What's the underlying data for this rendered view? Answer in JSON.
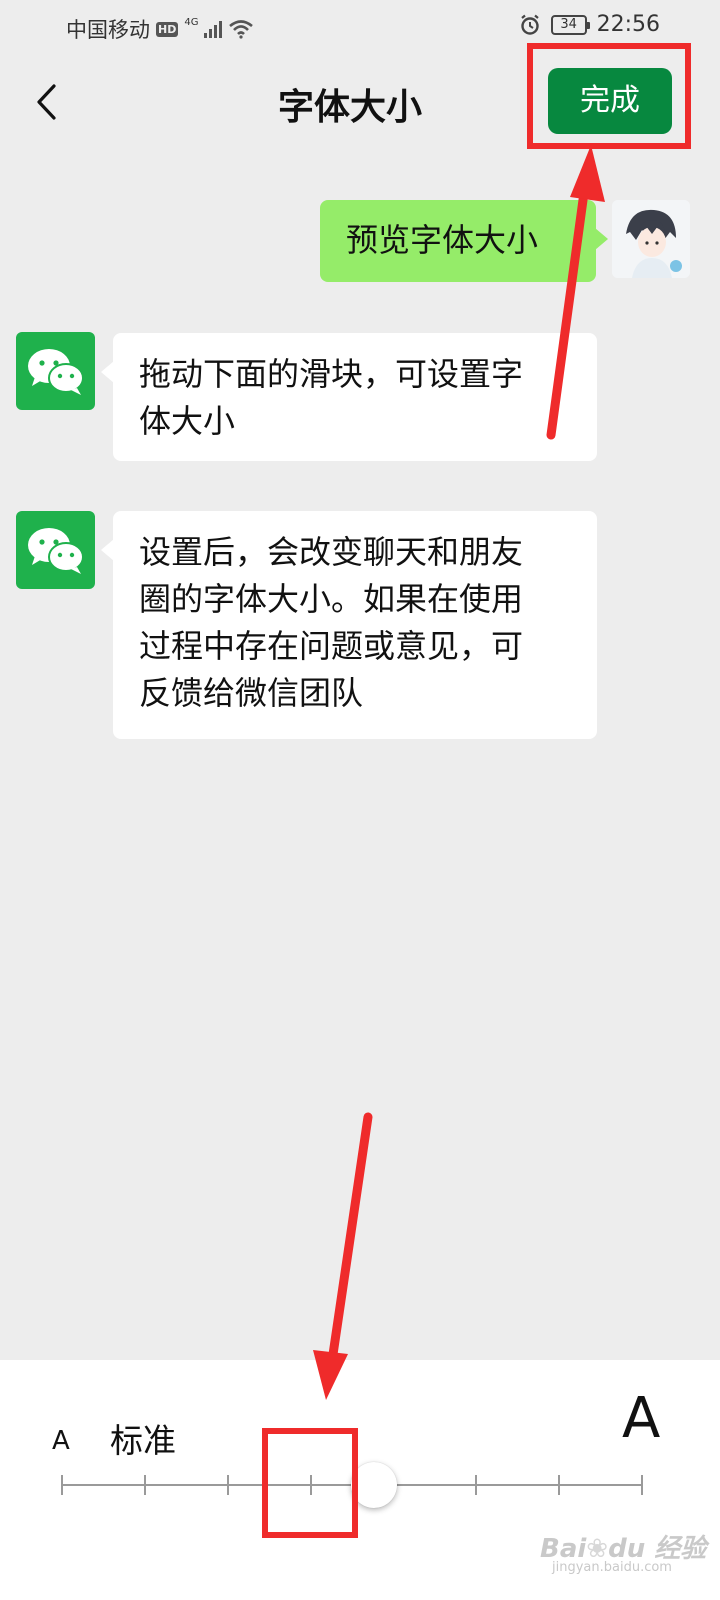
{
  "status_bar": {
    "carrier": "中国移动",
    "hd": "HD",
    "network": "4G",
    "battery": "34",
    "time": "22:56"
  },
  "header": {
    "title": "字体大小",
    "done_label": "完成"
  },
  "messages": [
    {
      "sender": "user",
      "text": "预览字体大小"
    },
    {
      "sender": "wechat",
      "lines": [
        "拖动下面的滑块，可设置字",
        "体大小"
      ]
    },
    {
      "sender": "wechat",
      "lines": [
        "设置后，会改变聊天和朋友",
        "圈的字体大小。如果在使用",
        "过程中存在问题或意见，可",
        "反馈给微信团队"
      ]
    }
  ],
  "font_slider": {
    "small_label": "A",
    "large_label": "A",
    "current_label": "标准",
    "steps": 8,
    "selected_step": 3
  },
  "watermark": {
    "text": "Bai du 经验",
    "sub": "jingyan.baidu.com"
  },
  "colors": {
    "accent_green": "#07883f",
    "bubble_green": "#95ec69",
    "annotation_red": "#ef2b2b",
    "background": "#ededed"
  }
}
